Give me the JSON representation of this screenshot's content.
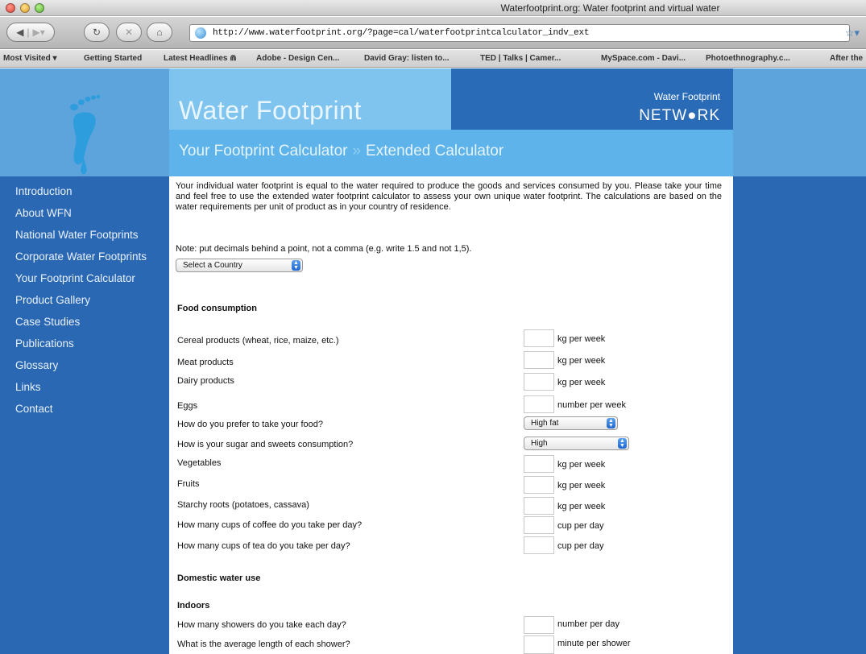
{
  "window": {
    "title": "Waterfootprint.org: Water footprint and virtual water"
  },
  "toolbar": {
    "url": "http://www.waterfootprint.org/?page=cal/waterfootprintcalculator_indv_ext"
  },
  "bookmarks": [
    "Most Visited ▾",
    "Getting Started",
    "Latest Headlines ⋒",
    "Adobe - Design Cen...",
    "David Gray: listen to...",
    "TED | Talks | Camer...",
    "MySpace.com - Davi...",
    "Photoethnography.c...",
    "After the"
  ],
  "banner": {
    "title": "Water Footprint",
    "subtitle_a": "Your Footprint Calculator",
    "subtitle_sep": "»",
    "subtitle_b": "Extended Calculator",
    "network_line1": "Water Footprint",
    "network_line2": "NETW●RK"
  },
  "nav": [
    "Introduction",
    "About WFN",
    "National Water Footprints",
    "Corporate Water Footprints",
    "Your Footprint Calculator",
    "Product Gallery",
    "Case Studies",
    "Publications",
    "Glossary",
    "Links",
    "Contact"
  ],
  "intro": "Your individual water footprint is equal to the water required to produce the goods and services consumed by you. Please take your time and feel free to use the extended water footprint calculator to assess your own unique water footprint. The calculations are based on the water requirements per unit of product as in your country of residence.",
  "note": "Note: put decimals behind a point, not a comma (e.g. write 1.5 and not 1,5).",
  "country_select": "Select a Country",
  "sections": {
    "food": "Food consumption",
    "domestic": "Domestic water use",
    "indoors": "Indoors"
  },
  "food_rows": [
    {
      "label": "Cereal products (wheat, rice, maize, etc.)",
      "unit": "kg per week"
    },
    {
      "label": "Meat products",
      "unit": "kg per week"
    },
    {
      "label": "Dairy products",
      "unit": "kg per week"
    },
    {
      "label": "Eggs",
      "unit": "number per week"
    },
    {
      "label": "How do you prefer to take your food?",
      "select": "High fat"
    },
    {
      "label": "How is your sugar and sweets consumption?",
      "select": "High"
    },
    {
      "label": "Vegetables",
      "unit": "kg per week"
    },
    {
      "label": "Fruits",
      "unit": "kg per week"
    },
    {
      "label": "Starchy roots (potatoes, cassava)",
      "unit": "kg per week"
    },
    {
      "label": "How many cups of coffee do you take per day?",
      "unit": "cup per day"
    },
    {
      "label": "How many cups of tea do you take per day?",
      "unit": "cup per day"
    }
  ],
  "indoor_rows": [
    {
      "label": "How many showers do you take each day?",
      "unit": "number per day"
    },
    {
      "label": "What is the average length of each shower?",
      "unit": "minute per shower"
    }
  ]
}
